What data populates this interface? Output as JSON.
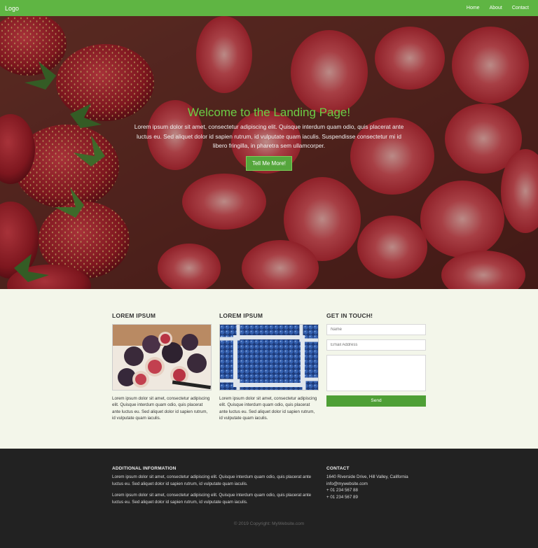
{
  "nav": {
    "logo": "Logo",
    "links": [
      "Home",
      "About",
      "Contact"
    ]
  },
  "hero": {
    "title": "Welcome to the Landing Page!",
    "text": "Lorem ipsum dolor sit amet, consectetur adipiscing elit. Quisque interdum quam odio, quis placerat ante luctus eu. Sed aliquet dolor id sapien rutrum, id vulputate quam iaculis. Suspendisse consectetur mi id libero fringilla, in pharetra sem ullamcorper.",
    "button": "Tell Me More!"
  },
  "columns": [
    {
      "heading": "LOREM IPSUM",
      "text": "Lorem ipsum dolor sit amet, consectetur adipiscing elit. Quisque interdum quam odio, quis placerat ante luctus eu. Sed aliquet dolor id sapien rutrum, id vulputate quam iaculis."
    },
    {
      "heading": "LOREM IPSUM",
      "text": "Lorem ipsum dolor sit amet, consectetur adipiscing elit. Quisque interdum quam odio, quis placerat ante luctus eu. Sed aliquet dolor id sapien rutrum, id vulputate quam iaculis."
    }
  ],
  "contact_form": {
    "heading": "GET IN TOUCH!",
    "name_placeholder": "Name",
    "email_placeholder": "Email Address",
    "send": "Send"
  },
  "footer": {
    "info_heading": "ADDITIONAL INFORMATION",
    "info_p1": "Lorem ipsum dolor sit amet, consectetur adipiscing elit. Quisque interdum quam odio, quis placerat ante luctus eu. Sed aliquet dolor id sapien rutrum, id vulputate quam iaculis.",
    "info_p2": "Lorem ipsum dolor sit amet, consectetur adipiscing elit. Quisque interdum quam odio, quis placerat ante luctus eu. Sed aliquet dolor id sapien rutrum, id vulputate quam iaculis.",
    "contact_heading": "CONTACT",
    "address": "1640 Riverside Drive, Hill Valley, California",
    "email": "info@mywebsite.com",
    "phone1": "+ 01 234 567 88",
    "phone2": "+ 01 234 567 89",
    "copyright": "© 2019 Copyright: MyWebsite.com"
  },
  "colors": {
    "brand_green": "#5fb543",
    "hero_title": "#6ccd45",
    "button_green": "#4e9f36",
    "footer_bg": "#222222",
    "section_bg": "#f3f6ea"
  }
}
